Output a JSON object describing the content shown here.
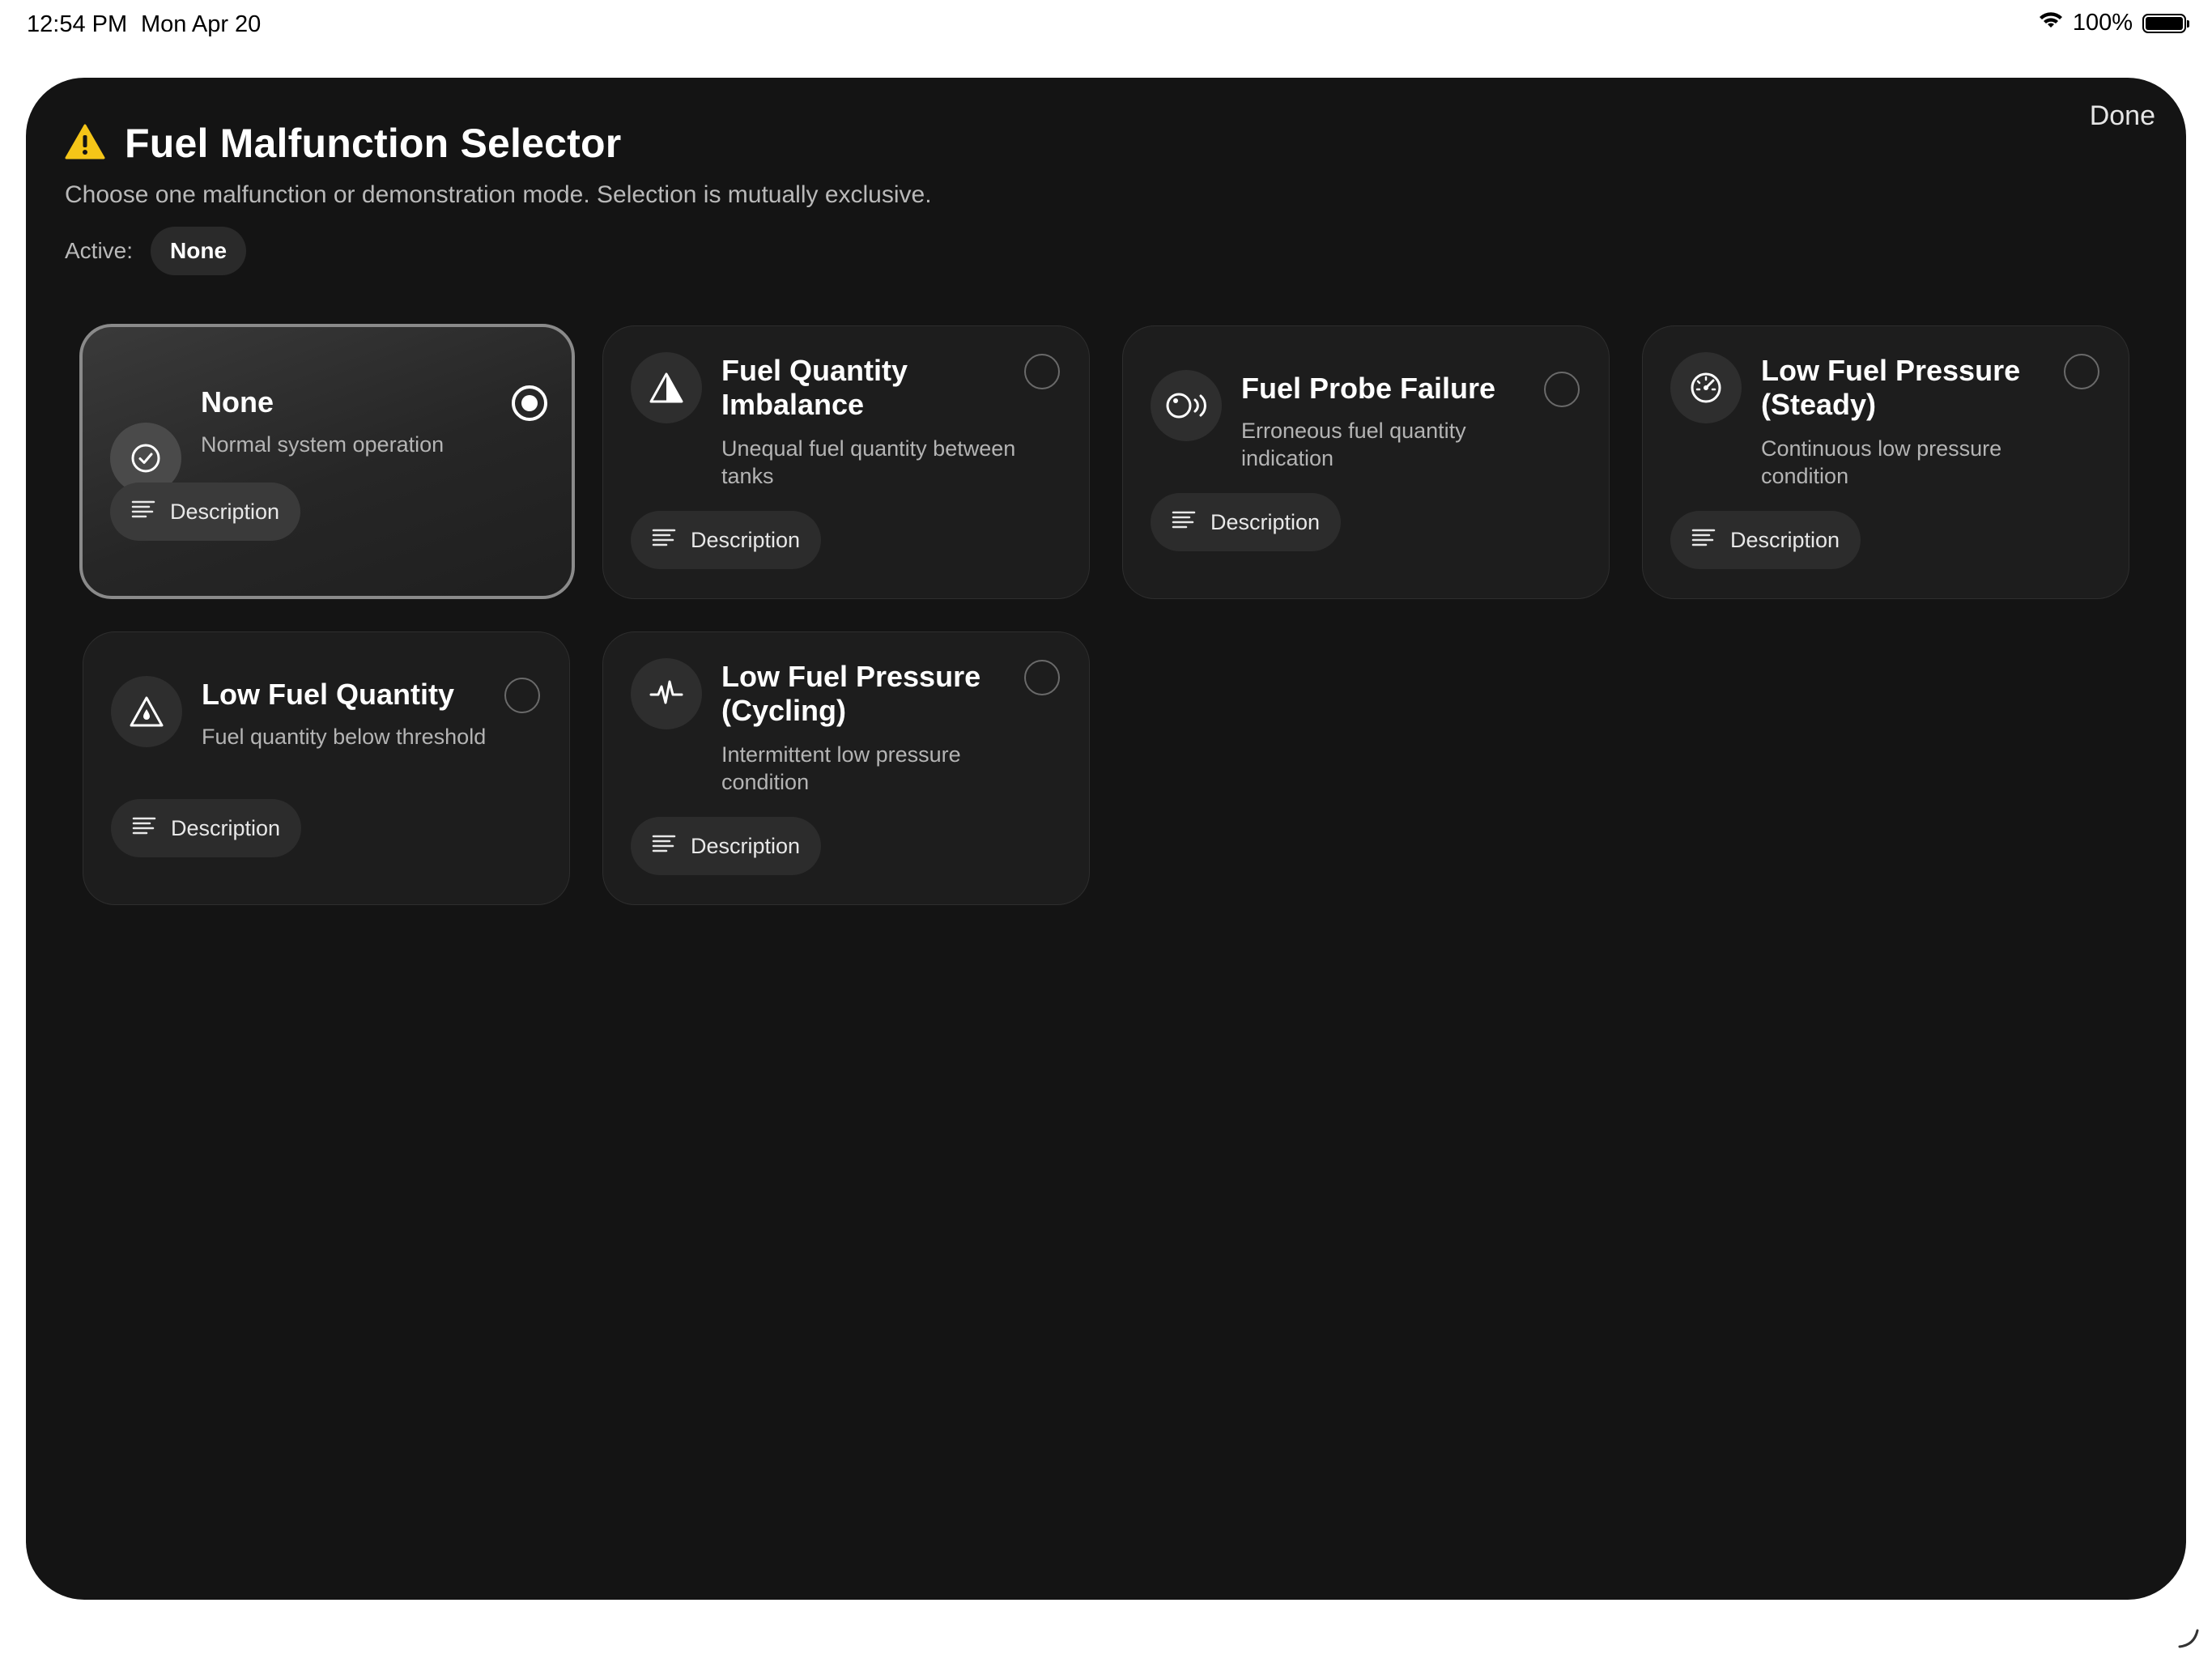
{
  "status_bar": {
    "time": "12:54 PM",
    "date": "Mon Apr 20",
    "battery": "100%"
  },
  "sheet": {
    "done_label": "Done",
    "title": "Fuel Malfunction Selector",
    "subtitle": "Choose one malfunction or demonstration mode. Selection is mutually exclusive.",
    "active_label": "Active:",
    "active_value": "None",
    "warning_color": "#F5C518"
  },
  "options": [
    {
      "title": "None",
      "subtitle": "Normal system operation",
      "icon": "checkmark-circle-icon",
      "selected": true,
      "button": "Description"
    },
    {
      "title": "Fuel Quantity Imbalance",
      "subtitle": "Unequal fuel quantity between tanks",
      "icon": "warning-triangle-icon",
      "selected": false,
      "button": "Description"
    },
    {
      "title": "Fuel Probe Failure",
      "subtitle": "Erroneous fuel quantity indication",
      "icon": "probe-signal-icon",
      "selected": false,
      "button": "Description"
    },
    {
      "title": "Low Fuel Pressure (Steady)",
      "subtitle": "Continuous low pressure condition",
      "icon": "gauge-icon",
      "selected": false,
      "button": "Description"
    },
    {
      "title": "Low Fuel Quantity",
      "subtitle": "Fuel quantity below threshold",
      "icon": "fuel-drop-warning-icon",
      "selected": false,
      "button": "Description"
    },
    {
      "title": "Low Fuel Pressure (Cycling)",
      "subtitle": "Intermittent low pressure condition",
      "icon": "waveform-icon",
      "selected": false,
      "button": "Description"
    }
  ]
}
